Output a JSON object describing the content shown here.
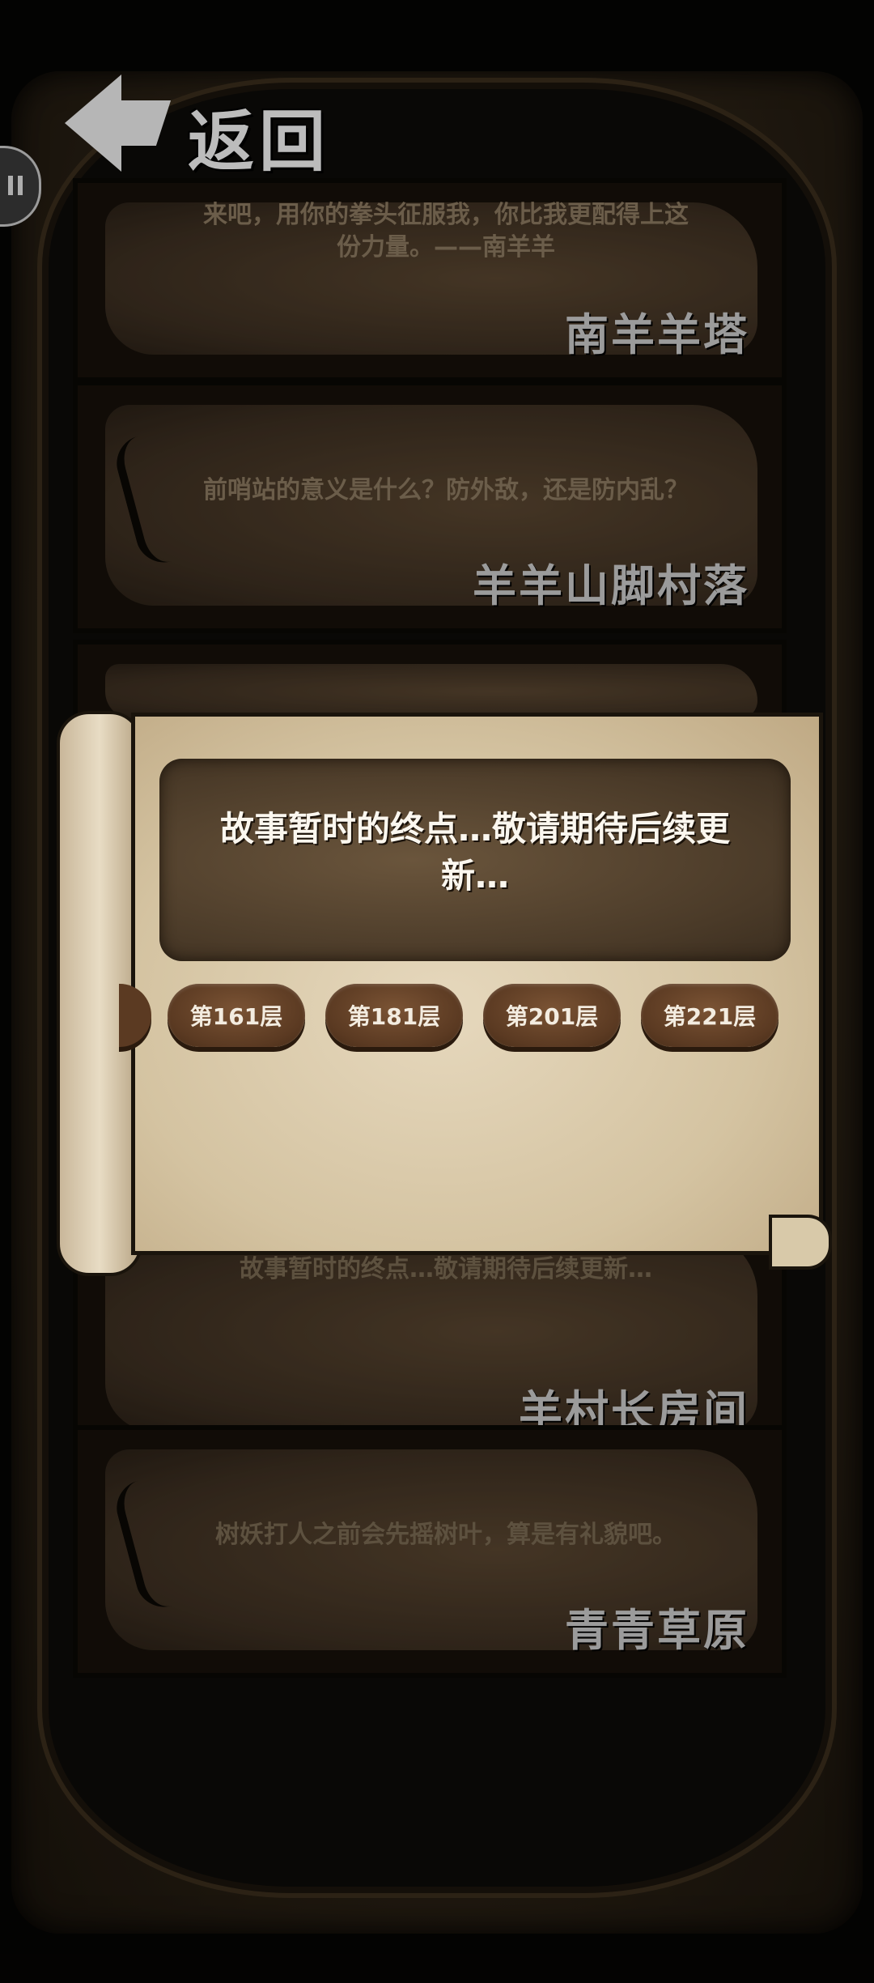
{
  "header": {
    "back_label": "返回"
  },
  "stages": [
    {
      "desc": "来吧，用你的拳头征服我，你比我更配得上这份力量。——南羊羊",
      "name": "南羊羊塔"
    },
    {
      "desc": "前哨站的意义是什么？防外敌，还是防内乱？",
      "name": "羊羊山脚村落"
    },
    {
      "desc": "",
      "name": ""
    },
    {
      "desc": "故事暂时的终点…敬请期待后续更新…",
      "name": "羊村长房间"
    },
    {
      "desc": "树妖打人之前会先摇树叶，算是有礼貌吧。",
      "name": "青青草原"
    }
  ],
  "dialog": {
    "message": "故事暂时的终点…敬请期待后续更新…",
    "floors": [
      "第161层",
      "第181层",
      "第201层",
      "第221层"
    ]
  }
}
